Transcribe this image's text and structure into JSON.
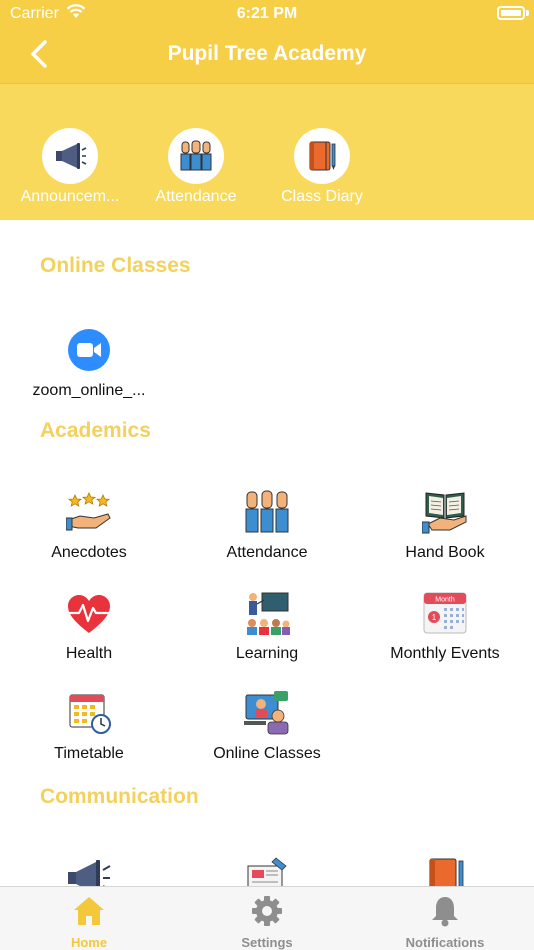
{
  "status_bar": {
    "carrier": "Carrier",
    "time": "6:21 PM"
  },
  "nav": {
    "title": "Pupil Tree Academy"
  },
  "quick_access": [
    {
      "label": "Announcem...",
      "icon": "megaphone-icon"
    },
    {
      "label": "Attendance",
      "icon": "raised-hands-icon"
    },
    {
      "label": "Class Diary",
      "icon": "notebook-icon"
    }
  ],
  "online_classes": {
    "title": "Online Classes",
    "items": [
      {
        "label": "zoom_online_...",
        "icon": "zoom-icon"
      }
    ]
  },
  "academics": {
    "title": "Academics",
    "items": [
      {
        "label": "Anecdotes",
        "icon": "stars-hand-icon"
      },
      {
        "label": "Attendance",
        "icon": "raised-hands-icon"
      },
      {
        "label": "Hand Book",
        "icon": "open-book-icon"
      },
      {
        "label": "Health",
        "icon": "heartbeat-icon"
      },
      {
        "label": "Learning",
        "icon": "classroom-icon"
      },
      {
        "label": "Monthly Events",
        "icon": "calendar-icon"
      },
      {
        "label": "Timetable",
        "icon": "timetable-icon"
      },
      {
        "label": "Online Classes",
        "icon": "video-call-icon"
      }
    ]
  },
  "communication": {
    "title": "Communication",
    "items": [
      {
        "icon": "megaphone-icon"
      },
      {
        "icon": "newspaper-icon"
      },
      {
        "icon": "notebook-icon"
      }
    ]
  },
  "tabs": [
    {
      "label": "Home",
      "icon": "home-icon",
      "active": true
    },
    {
      "label": "Settings",
      "icon": "gear-icon",
      "active": false
    },
    {
      "label": "Notifications",
      "icon": "bell-icon",
      "active": false
    }
  ],
  "colors": {
    "primary": "#f7cf47",
    "band": "#f9d95b",
    "section_title": "#f3d15c",
    "tab_active": "#f3c83a",
    "tab_inactive": "#8e8e8e"
  }
}
